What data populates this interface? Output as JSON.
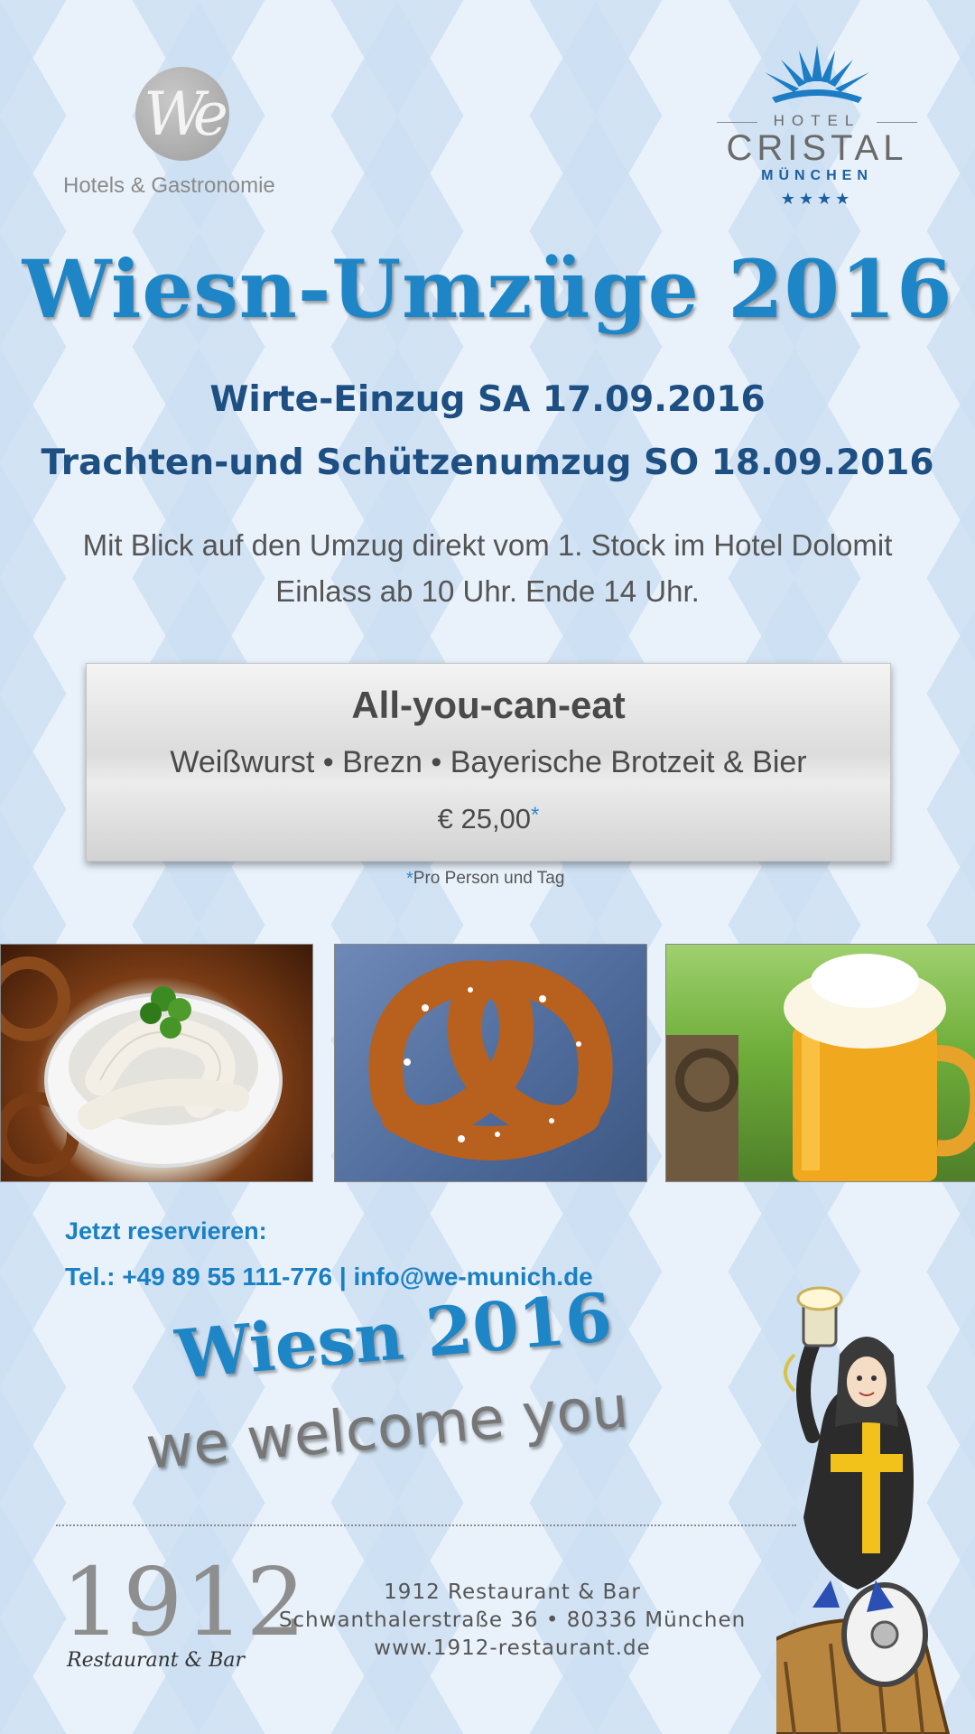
{
  "brand_we": {
    "tagline": "Hotels & Gastronomie",
    "mark": "We"
  },
  "brand_cristal": {
    "hotel": "HOTEL",
    "name": "CRISTAL",
    "city": "MÜNCHEN",
    "stars": "★★★★"
  },
  "title": "Wiesn-Umzüge 2016",
  "dates": [
    "Wirte-Einzug SA 17.09.2016",
    "Trachten-und Schützenumzug SO 18.09.2016"
  ],
  "info": [
    "Mit Blick auf den Umzug direkt vom 1. Stock im Hotel Dolomit",
    "Einlass ab 10 Uhr. Ende 14 Uhr."
  ],
  "offer": {
    "title": "All-you-can-eat",
    "items": "Weißwurst • Brezn • Bayerische Brotzeit & Bier",
    "price": "€ 25,00",
    "asterisk": "*"
  },
  "footnote": {
    "asterisk": "*",
    "text": "Pro Person und Tag"
  },
  "reserve": {
    "label": "Jetzt reservieren:",
    "contact": "Tel.: +49 89 55 111-776  |  info@we-munich.de"
  },
  "slogan": {
    "title": "Wiesn 2016",
    "subtitle": "we welcome you"
  },
  "restaurant": {
    "logo_number": "1912",
    "logo_sub": "Restaurant & Bar",
    "name": "1912 Restaurant & Bar",
    "address": "Schwanthalerstraße 36 • 80336 München",
    "web": "www.1912-restaurant.de"
  },
  "colors": {
    "accent_blue": "#1e86c6",
    "dark_blue": "#1d4f82",
    "text_gray": "#555555"
  }
}
